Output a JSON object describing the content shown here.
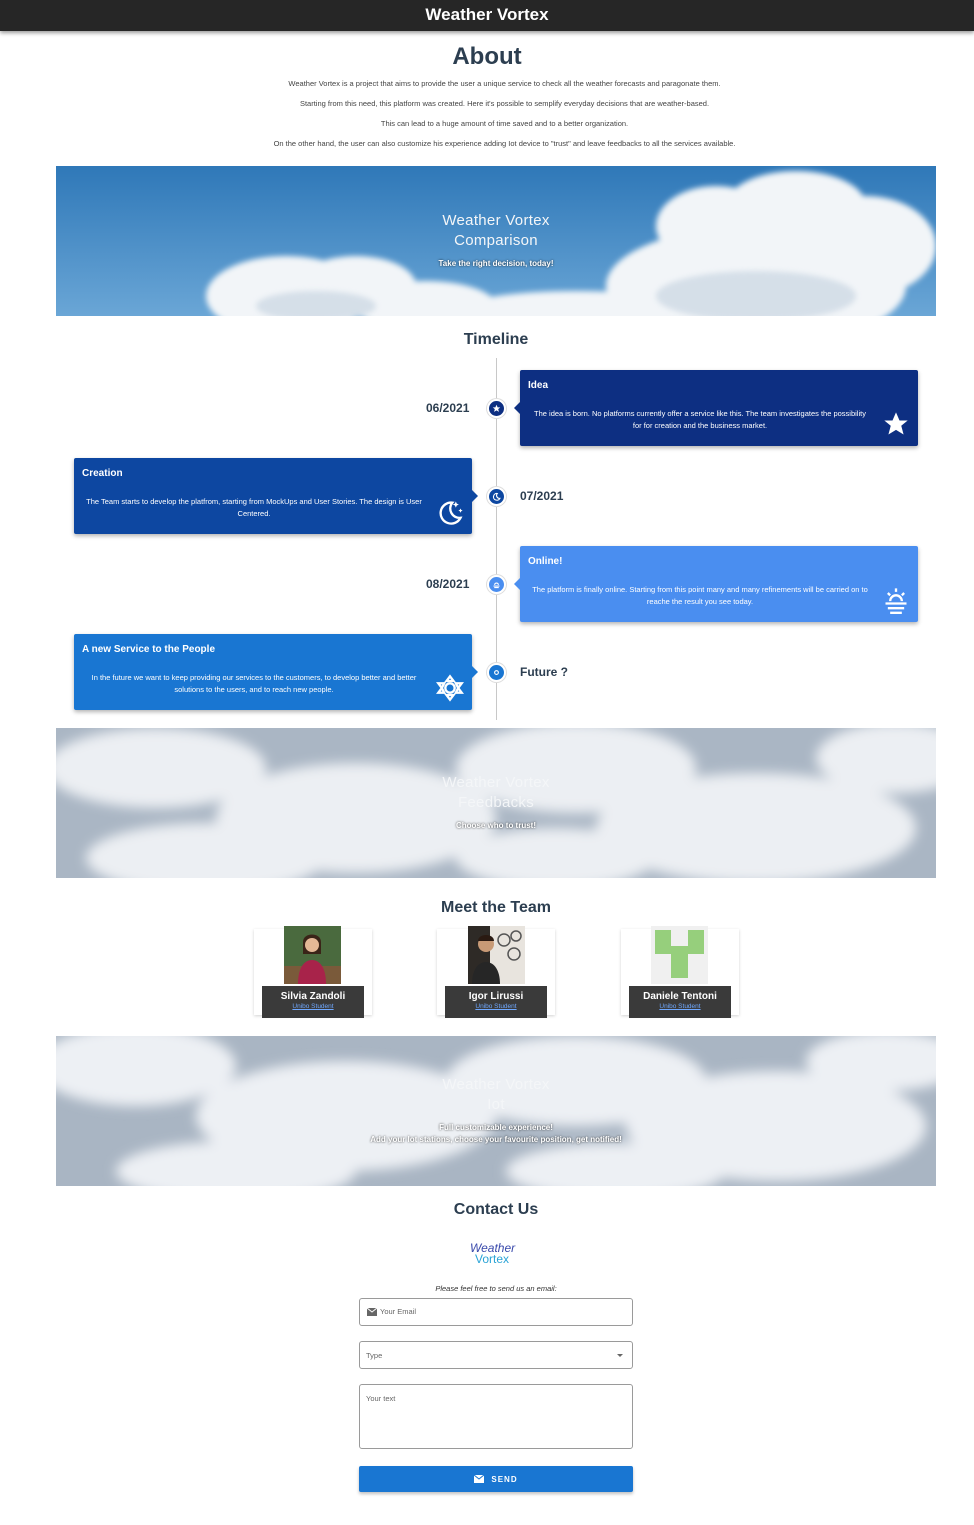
{
  "app": {
    "title": "Weather Vortex"
  },
  "about": {
    "title": "About",
    "paragraphs": [
      "Weather Vortex is a project that aims to provide the user a unique service to check all the weather forecasts and paragonate them.",
      "Starting from this need, this platform was created. Here it's possible to semplify everyday decisions that are weather-based.",
      "This can lead to a huge amount of time saved and to a better organization.",
      "On the other hand, the user can also customize his experience adding Iot device to \"trust\" and leave feedbacks to all the services available."
    ]
  },
  "banners": [
    {
      "title1": "Weather Vortex",
      "title2": "Comparison",
      "subtitle": "Take the right decision, today!"
    },
    {
      "title1": "Weather Vortex",
      "title2": "Feedbacks",
      "subtitle": "Choose who to trust!"
    },
    {
      "title1": "Weather Vortex",
      "title2": "Iot",
      "subtitle": "Full customizable experience!",
      "subtitle2": "Add your Iot stations, choose your favourite position, get notified!"
    }
  ],
  "timeline": {
    "title": "Timeline",
    "events": [
      {
        "date": "06/2021",
        "title": "Idea",
        "text": "The idea is born. No platforms currently offer a service like this. The team investigates the possibility for for creation and the business market.",
        "icon": "star-icon",
        "color": "#0d2f82"
      },
      {
        "date": "07/2021",
        "title": "Creation",
        "text": "The Team starts to develop the platfrom, starting from MockUps and User Stories. The design is User Centered.",
        "icon": "moon-stars-icon",
        "color": "#0d47a1"
      },
      {
        "date": "08/2021",
        "title": "Online!",
        "text": "The platform is finally online. Starting from this point many and many refinements will be carried on to reache the result you see today.",
        "icon": "sunrise-icon",
        "color": "#4a8ef0"
      },
      {
        "date": "Future ?",
        "title": "A new Service to the People",
        "text": "In the future we want to keep providing our services to the customers, to develop better and better solutions to the users, and to reach new people.",
        "icon": "sun-icon",
        "color": "#1976d2"
      }
    ]
  },
  "team": {
    "title": "Meet the Team",
    "members": [
      {
        "name": "Silvia Zandoli",
        "role": "Unibo Student"
      },
      {
        "name": "Igor Lirussi",
        "role": "Unibo Student"
      },
      {
        "name": "Daniele Tentoni",
        "role": "Unibo Student"
      }
    ]
  },
  "contact": {
    "title": "Contact Us",
    "logo_line1": "Weather",
    "logo_line2": "Vortex",
    "hint": "Please feel free to send us an email:",
    "email_placeholder": "Your Email",
    "type_placeholder": "Type",
    "text_placeholder": "Your text",
    "send_label": "SEND"
  },
  "colors": {
    "accent": "#1976d2",
    "topbar": "#262626"
  }
}
